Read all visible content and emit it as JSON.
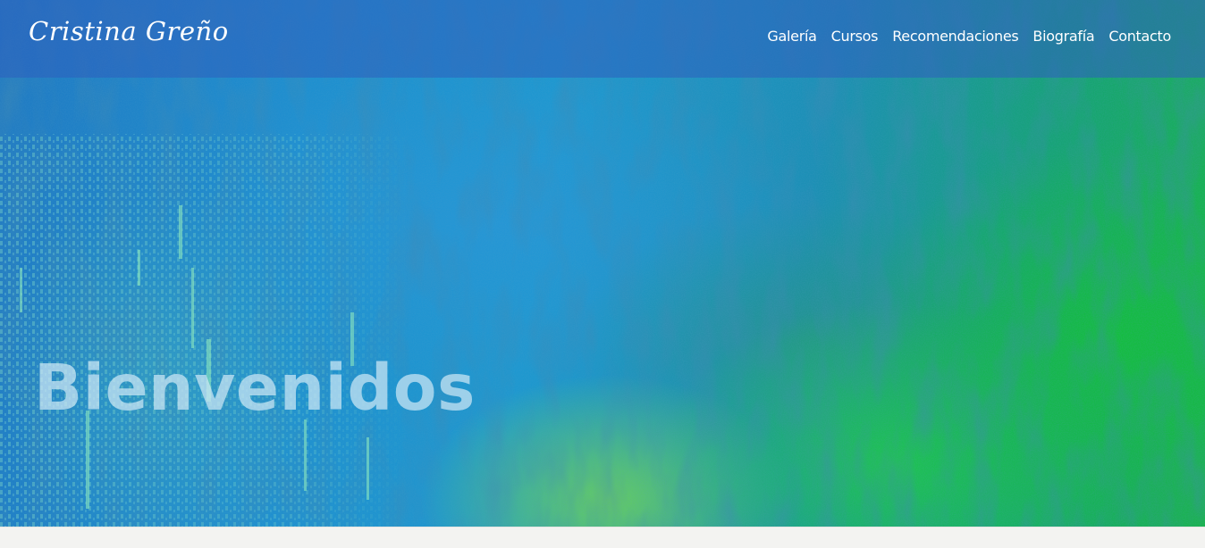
{
  "header": {
    "logo_text": "Cristina Greño"
  },
  "nav": {
    "items": [
      {
        "label": "Galería"
      },
      {
        "label": "Cursos"
      },
      {
        "label": "Recomendaciones"
      },
      {
        "label": "Biografía"
      },
      {
        "label": "Contacto"
      }
    ]
  },
  "hero": {
    "heading": "Bienvenidos"
  },
  "colors": {
    "navbar": "#2d5fbe",
    "hero_blue": "#1e8fcf",
    "hero_green": "#19b44a",
    "heading_text": "#cde8f5"
  }
}
